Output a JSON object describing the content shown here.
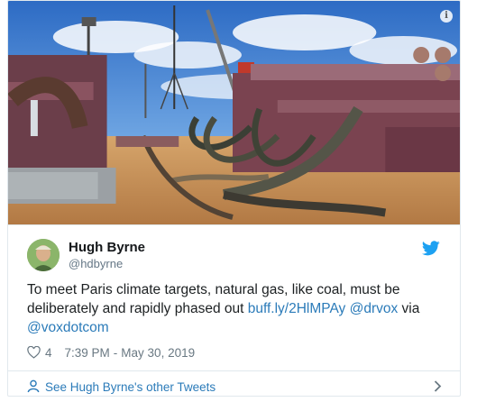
{
  "tweet": {
    "author_name": "Hugh Byrne",
    "author_handle": "@hdbyrne",
    "text_part1": "To meet Paris climate targets, natural gas, like coal, must be deliberately and rapidly phased out ",
    "link1": "buff.ly/2HlMPAy",
    "space1": " ",
    "link2": "@drvox",
    "text_part2": " via ",
    "link3": "@voxdotcom",
    "like_count": "4",
    "time": "7:39 PM",
    "separator": "-",
    "date": "May 30, 2019",
    "see_more_label": "See Hugh Byrne's other Tweets",
    "info_label": "i"
  },
  "icons": {
    "info": "info-icon",
    "bird": "twitter-bird-icon",
    "heart": "heart-icon",
    "person": "person-icon",
    "chevron": "chevron-right-icon"
  },
  "colors": {
    "link": "#2b7bb9",
    "brand": "#1da1f2",
    "text": "#1c2022",
    "muted": "#697882"
  }
}
